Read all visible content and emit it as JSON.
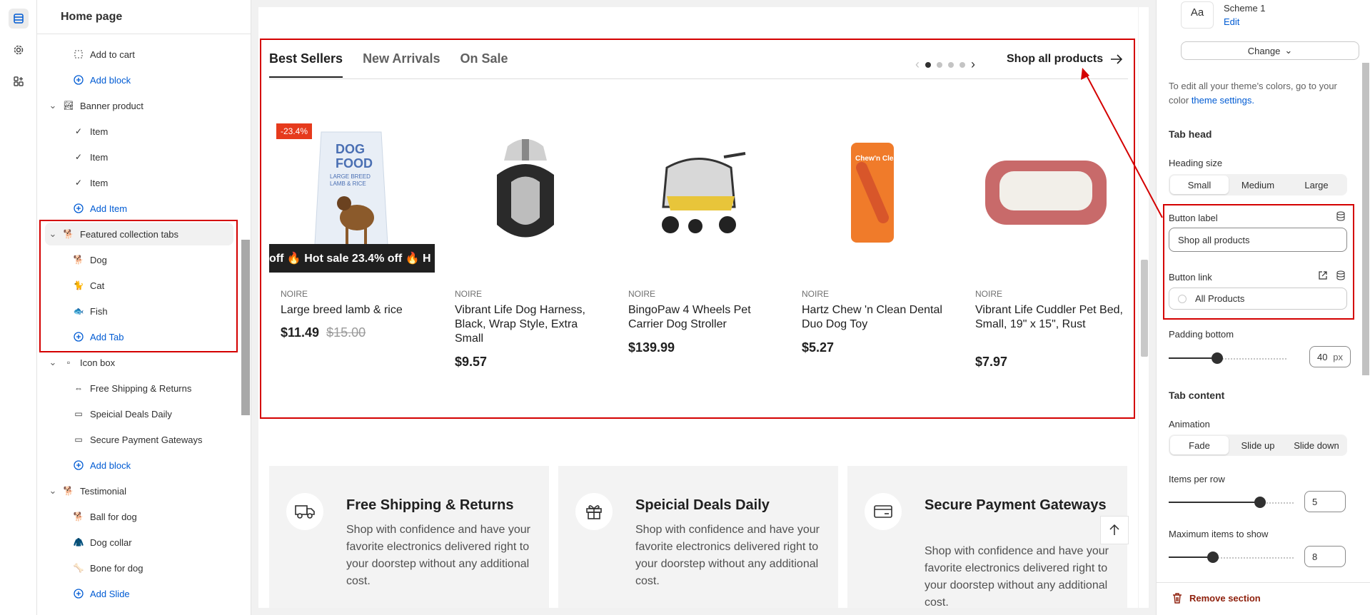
{
  "sidebar": {
    "title": "Home page",
    "rows": [
      {
        "label": "Add to cart",
        "icon": "dashed-square-icon"
      },
      {
        "label": "Add block",
        "icon": "plus-circle-icon"
      },
      {
        "label": "Banner product",
        "icon": "image-icon"
      },
      {
        "label": "Item",
        "icon": "check-icon"
      },
      {
        "label": "Item",
        "icon": "check-icon"
      },
      {
        "label": "Item",
        "icon": "check-icon"
      },
      {
        "label": "Add Item",
        "icon": "plus-circle-icon"
      },
      {
        "label": "Featured collection tabs",
        "icon": "collection-icon"
      },
      {
        "label": "Dog",
        "icon": "dog-icon"
      },
      {
        "label": "Cat",
        "icon": "cat-icon"
      },
      {
        "label": "Fish",
        "icon": "fish-icon"
      },
      {
        "label": "Add Tab",
        "icon": "plus-circle-icon"
      },
      {
        "label": "Icon box",
        "icon": "icon-box-icon"
      },
      {
        "label": "Free Shipping & Returns",
        "icon": "truck-icon"
      },
      {
        "label": "Speicial Deals Daily",
        "icon": "gift-icon"
      },
      {
        "label": "Secure Payment Gateways",
        "icon": "card-icon"
      },
      {
        "label": "Add block",
        "icon": "plus-circle-icon"
      },
      {
        "label": "Testimonial",
        "icon": "testimonial-icon"
      },
      {
        "label": "Ball for dog",
        "icon": "ball-icon"
      },
      {
        "label": "Dog collar",
        "icon": "collar-icon"
      },
      {
        "label": "Bone for dog",
        "icon": "bone-icon"
      },
      {
        "label": "Add Slide",
        "icon": "plus-circle-icon"
      }
    ]
  },
  "preview": {
    "tabs": [
      "Best Sellers",
      "New Arrivals",
      "On Sale"
    ],
    "shop_all": "Shop all products",
    "marquee": "off 🔥 Hot sale 23.4% off 🔥 H",
    "products": [
      {
        "badge": "-23.4%",
        "brand": "NOIRE",
        "name": "Large breed lamb & rice",
        "price": "$11.49",
        "old_price": "$15.00"
      },
      {
        "brand": "NOIRE",
        "name": "Vibrant Life Dog Harness, Black, Wrap Style, Extra Small",
        "price": "$9.57"
      },
      {
        "brand": "NOIRE",
        "name": "BingoPaw 4 Wheels Pet Carrier Dog Stroller",
        "price": "$139.99"
      },
      {
        "brand": "NOIRE",
        "name": "Hartz Chew 'n Clean Dental Duo Dog Toy",
        "price": "$5.27"
      },
      {
        "brand": "NOIRE",
        "name": "Vibrant Life Cuddler Pet Bed, Small, 19\" x 15\", Rust",
        "price": "$7.97"
      }
    ],
    "icon_boxes": [
      {
        "title": "Free Shipping & Returns",
        "desc": "Shop with confidence and have your favorite electronics delivered right to your doorstep without any additional cost.",
        "icon": "truck-icon"
      },
      {
        "title": "Speicial Deals Daily",
        "desc": "Shop with confidence and have your favorite electronics delivered right to your doorstep without any additional cost.",
        "icon": "gift-icon"
      },
      {
        "title": "Secure Payment Gateways",
        "desc": "Shop with confidence and have your favorite electronics delivered right to your doorstep without any additional cost.",
        "icon": "card-icon"
      }
    ],
    "dog_food_pkg": {
      "line1": "DOG",
      "line2": "FOOD",
      "line3": "LARGE BREED",
      "line4": "LAMB & RICE"
    },
    "toy_label": "Chew'n Clean"
  },
  "panel": {
    "scheme_preview": "Aa",
    "scheme_name": "Scheme 1",
    "edit": "Edit",
    "change": "Change",
    "note_prefix": "To edit all your theme's colors, go to your color",
    "note_link": "theme settings.",
    "tab_head": "Tab head",
    "heading_size_label": "Heading size",
    "heading_sizes": [
      "Small",
      "Medium",
      "Large"
    ],
    "button_label_label": "Button label",
    "button_label_value": "Shop all products",
    "button_link_label": "Button link",
    "button_link_value": "All Products",
    "padding_bottom_label": "Padding bottom",
    "padding_bottom_value": "40",
    "padding_unit": "px",
    "tab_content": "Tab content",
    "animation_label": "Animation",
    "animations": [
      "Fade",
      "Slide up",
      "Slide down"
    ],
    "items_per_row_label": "Items per row",
    "items_per_row": "5",
    "max_items_label": "Maximum items to show",
    "max_items": "8",
    "remove": "Remove section"
  },
  "colors": {
    "accent": "#005bd3",
    "highlight": "#d40000",
    "sale": "#e63a1c",
    "remove": "#8e1f0b"
  }
}
